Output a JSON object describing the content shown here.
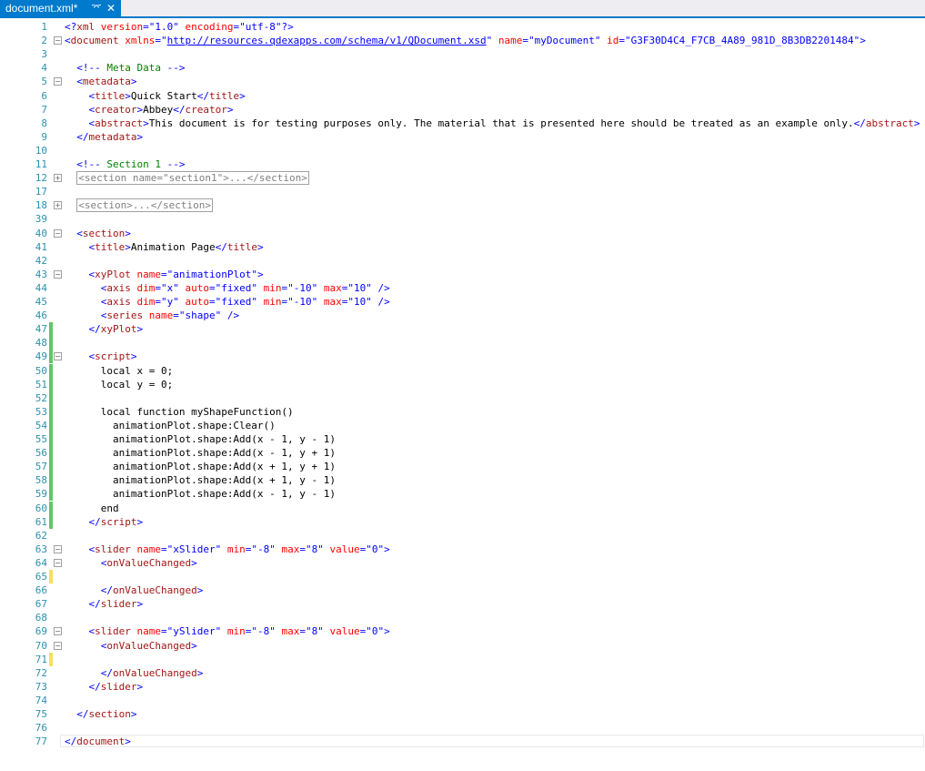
{
  "tab": {
    "title": "document.xml*",
    "pin_icon": "pin-icon",
    "close_icon": "close-icon"
  },
  "colors": {
    "tag": "#a31515",
    "attr_name": "#ff0000",
    "attr_value": "#0000ff",
    "bracket": "#0000ff",
    "comment": "#008000",
    "link": "#0000ff",
    "line_number": "#2b91af",
    "accent": "#007acc",
    "saved_change": "#5fc85f",
    "unsaved_change": "#f5e15a"
  },
  "lines": [
    {
      "n": "1",
      "fold": "",
      "change": "",
      "segs": [
        [
          "b",
          "<?"
        ],
        [
          "t",
          "xml"
        ],
        [
          "t",
          " "
        ],
        [
          "a",
          "version"
        ],
        [
          "b",
          "="
        ],
        [
          "v",
          "\"1.0\""
        ],
        [
          "t",
          " "
        ],
        [
          "a",
          "encoding"
        ],
        [
          "b",
          "="
        ],
        [
          "v",
          "\"utf-8\""
        ],
        [
          "b",
          "?>"
        ]
      ]
    },
    {
      "n": "2",
      "fold": "minus",
      "change": "",
      "segs": [
        [
          "b",
          "<"
        ],
        [
          "t",
          "document"
        ],
        [
          "t",
          " "
        ],
        [
          "a",
          "xmlns"
        ],
        [
          "b",
          "="
        ],
        [
          "b",
          "\""
        ],
        [
          "l",
          "http://resources.qdexapps.com/schema/v1/QDocument.xsd"
        ],
        [
          "b",
          "\""
        ],
        [
          "t",
          " "
        ],
        [
          "a",
          "name"
        ],
        [
          "b",
          "="
        ],
        [
          "v",
          "\"myDocument\""
        ],
        [
          "t",
          " "
        ],
        [
          "a",
          "id"
        ],
        [
          "b",
          "="
        ],
        [
          "v",
          "\"G3F30D4C4_F7CB_4A89_981D_8B3DB2201484\""
        ],
        [
          "b",
          ">"
        ]
      ]
    },
    {
      "n": "3",
      "fold": "",
      "change": "",
      "segs": []
    },
    {
      "n": "4",
      "fold": "",
      "change": "",
      "segs": [
        [
          "p",
          "  "
        ],
        [
          "b",
          "<!--"
        ],
        [
          "c",
          " Meta Data "
        ],
        [
          "b",
          "-->"
        ]
      ]
    },
    {
      "n": "5",
      "fold": "minus",
      "change": "",
      "segs": [
        [
          "p",
          "  "
        ],
        [
          "b",
          "<"
        ],
        [
          "t",
          "metadata"
        ],
        [
          "b",
          ">"
        ]
      ]
    },
    {
      "n": "6",
      "fold": "",
      "change": "",
      "segs": [
        [
          "p",
          "    "
        ],
        [
          "b",
          "<"
        ],
        [
          "t",
          "title"
        ],
        [
          "b",
          ">"
        ],
        [
          "x",
          "Quick Start"
        ],
        [
          "b",
          "</"
        ],
        [
          "t",
          "title"
        ],
        [
          "b",
          ">"
        ]
      ]
    },
    {
      "n": "7",
      "fold": "",
      "change": "",
      "segs": [
        [
          "p",
          "    "
        ],
        [
          "b",
          "<"
        ],
        [
          "t",
          "creator"
        ],
        [
          "b",
          ">"
        ],
        [
          "x",
          "Abbey"
        ],
        [
          "b",
          "</"
        ],
        [
          "t",
          "creator"
        ],
        [
          "b",
          ">"
        ]
      ]
    },
    {
      "n": "8",
      "fold": "",
      "change": "",
      "segs": [
        [
          "p",
          "    "
        ],
        [
          "b",
          "<"
        ],
        [
          "t",
          "abstract"
        ],
        [
          "b",
          ">"
        ],
        [
          "x",
          "This document is for testing purposes only. The material that is presented here should be treated as an example only."
        ],
        [
          "b",
          "</"
        ],
        [
          "t",
          "abstract"
        ],
        [
          "b",
          ">"
        ]
      ]
    },
    {
      "n": "9",
      "fold": "",
      "change": "",
      "segs": [
        [
          "p",
          "  "
        ],
        [
          "b",
          "</"
        ],
        [
          "t",
          "metadata"
        ],
        [
          "b",
          ">"
        ]
      ]
    },
    {
      "n": "10",
      "fold": "",
      "change": "",
      "segs": []
    },
    {
      "n": "11",
      "fold": "",
      "change": "",
      "segs": [
        [
          "p",
          "  "
        ],
        [
          "b",
          "<!--"
        ],
        [
          "c",
          " Section 1 "
        ],
        [
          "b",
          "-->"
        ]
      ]
    },
    {
      "n": "12",
      "fold": "plus",
      "change": "",
      "segs": [
        [
          "p",
          "  "
        ],
        [
          "k",
          "<section name=\"section1\">...</section>"
        ]
      ]
    },
    {
      "n": "17",
      "fold": "",
      "change": "",
      "segs": []
    },
    {
      "n": "18",
      "fold": "plus",
      "change": "",
      "segs": [
        [
          "p",
          "  "
        ],
        [
          "k",
          "<section>...</section>"
        ]
      ]
    },
    {
      "n": "39",
      "fold": "",
      "change": "",
      "segs": []
    },
    {
      "n": "40",
      "fold": "minus",
      "change": "",
      "segs": [
        [
          "p",
          "  "
        ],
        [
          "b",
          "<"
        ],
        [
          "t",
          "section"
        ],
        [
          "b",
          ">"
        ]
      ]
    },
    {
      "n": "41",
      "fold": "",
      "change": "",
      "segs": [
        [
          "p",
          "    "
        ],
        [
          "b",
          "<"
        ],
        [
          "t",
          "title"
        ],
        [
          "b",
          ">"
        ],
        [
          "x",
          "Animation Page"
        ],
        [
          "b",
          "</"
        ],
        [
          "t",
          "title"
        ],
        [
          "b",
          ">"
        ]
      ]
    },
    {
      "n": "42",
      "fold": "",
      "change": "",
      "segs": []
    },
    {
      "n": "43",
      "fold": "minus",
      "change": "",
      "segs": [
        [
          "p",
          "    "
        ],
        [
          "b",
          "<"
        ],
        [
          "t",
          "xyPlot"
        ],
        [
          "t",
          " "
        ],
        [
          "a",
          "name"
        ],
        [
          "b",
          "="
        ],
        [
          "v",
          "\"animationPlot\""
        ],
        [
          "b",
          ">"
        ]
      ]
    },
    {
      "n": "44",
      "fold": "",
      "change": "",
      "segs": [
        [
          "p",
          "      "
        ],
        [
          "b",
          "<"
        ],
        [
          "t",
          "axis"
        ],
        [
          "t",
          " "
        ],
        [
          "a",
          "dim"
        ],
        [
          "b",
          "="
        ],
        [
          "v",
          "\"x\""
        ],
        [
          "t",
          " "
        ],
        [
          "a",
          "auto"
        ],
        [
          "b",
          "="
        ],
        [
          "v",
          "\"fixed\""
        ],
        [
          "t",
          " "
        ],
        [
          "a",
          "min"
        ],
        [
          "b",
          "="
        ],
        [
          "v",
          "\"-10\""
        ],
        [
          "t",
          " "
        ],
        [
          "a",
          "max"
        ],
        [
          "b",
          "="
        ],
        [
          "v",
          "\"10\""
        ],
        [
          "t",
          " "
        ],
        [
          "b",
          "/>"
        ]
      ]
    },
    {
      "n": "45",
      "fold": "",
      "change": "",
      "segs": [
        [
          "p",
          "      "
        ],
        [
          "b",
          "<"
        ],
        [
          "t",
          "axis"
        ],
        [
          "t",
          " "
        ],
        [
          "a",
          "dim"
        ],
        [
          "b",
          "="
        ],
        [
          "v",
          "\"y\""
        ],
        [
          "t",
          " "
        ],
        [
          "a",
          "auto"
        ],
        [
          "b",
          "="
        ],
        [
          "v",
          "\"fixed\""
        ],
        [
          "t",
          " "
        ],
        [
          "a",
          "min"
        ],
        [
          "b",
          "="
        ],
        [
          "v",
          "\"-10\""
        ],
        [
          "t",
          " "
        ],
        [
          "a",
          "max"
        ],
        [
          "b",
          "="
        ],
        [
          "v",
          "\"10\""
        ],
        [
          "t",
          " "
        ],
        [
          "b",
          "/>"
        ]
      ]
    },
    {
      "n": "46",
      "fold": "",
      "change": "",
      "segs": [
        [
          "p",
          "      "
        ],
        [
          "b",
          "<"
        ],
        [
          "t",
          "series"
        ],
        [
          "t",
          " "
        ],
        [
          "a",
          "name"
        ],
        [
          "b",
          "="
        ],
        [
          "v",
          "\"shape\""
        ],
        [
          "t",
          " "
        ],
        [
          "b",
          "/>"
        ]
      ]
    },
    {
      "n": "47",
      "fold": "",
      "change": "saved",
      "segs": [
        [
          "p",
          "    "
        ],
        [
          "b",
          "</"
        ],
        [
          "t",
          "xyPlot"
        ],
        [
          "b",
          ">"
        ]
      ]
    },
    {
      "n": "48",
      "fold": "",
      "change": "saved",
      "segs": []
    },
    {
      "n": "49",
      "fold": "minus",
      "change": "saved",
      "segs": [
        [
          "p",
          "    "
        ],
        [
          "b",
          "<"
        ],
        [
          "t",
          "script"
        ],
        [
          "b",
          ">"
        ]
      ]
    },
    {
      "n": "50",
      "fold": "",
      "change": "saved",
      "segs": [
        [
          "p",
          "      "
        ],
        [
          "x",
          "local x = 0;"
        ]
      ]
    },
    {
      "n": "51",
      "fold": "",
      "change": "saved",
      "segs": [
        [
          "p",
          "      "
        ],
        [
          "x",
          "local y = 0;"
        ]
      ]
    },
    {
      "n": "52",
      "fold": "",
      "change": "saved",
      "segs": []
    },
    {
      "n": "53",
      "fold": "",
      "change": "saved",
      "segs": [
        [
          "p",
          "      "
        ],
        [
          "x",
          "local function myShapeFunction()"
        ]
      ]
    },
    {
      "n": "54",
      "fold": "",
      "change": "saved",
      "segs": [
        [
          "p",
          "        "
        ],
        [
          "x",
          "animationPlot.shape:Clear()"
        ]
      ]
    },
    {
      "n": "55",
      "fold": "",
      "change": "saved",
      "segs": [
        [
          "p",
          "        "
        ],
        [
          "x",
          "animationPlot.shape:Add(x - 1, y - 1)"
        ]
      ]
    },
    {
      "n": "56",
      "fold": "",
      "change": "saved",
      "segs": [
        [
          "p",
          "        "
        ],
        [
          "x",
          "animationPlot.shape:Add(x - 1, y + 1)"
        ]
      ]
    },
    {
      "n": "57",
      "fold": "",
      "change": "saved",
      "segs": [
        [
          "p",
          "        "
        ],
        [
          "x",
          "animationPlot.shape:Add(x + 1, y + 1)"
        ]
      ]
    },
    {
      "n": "58",
      "fold": "",
      "change": "saved",
      "segs": [
        [
          "p",
          "        "
        ],
        [
          "x",
          "animationPlot.shape:Add(x + 1, y - 1)"
        ]
      ]
    },
    {
      "n": "59",
      "fold": "",
      "change": "saved",
      "segs": [
        [
          "p",
          "        "
        ],
        [
          "x",
          "animationPlot.shape:Add(x - 1, y - 1)"
        ]
      ]
    },
    {
      "n": "60",
      "fold": "",
      "change": "saved",
      "segs": [
        [
          "p",
          "      "
        ],
        [
          "x",
          "end"
        ]
      ]
    },
    {
      "n": "61",
      "fold": "",
      "change": "saved",
      "segs": [
        [
          "p",
          "    "
        ],
        [
          "b",
          "</"
        ],
        [
          "t",
          "script"
        ],
        [
          "b",
          ">"
        ]
      ]
    },
    {
      "n": "62",
      "fold": "",
      "change": "",
      "segs": []
    },
    {
      "n": "63",
      "fold": "minus",
      "change": "",
      "segs": [
        [
          "p",
          "    "
        ],
        [
          "b",
          "<"
        ],
        [
          "t",
          "slider"
        ],
        [
          "t",
          " "
        ],
        [
          "a",
          "name"
        ],
        [
          "b",
          "="
        ],
        [
          "v",
          "\"xSlider\""
        ],
        [
          "t",
          " "
        ],
        [
          "a",
          "min"
        ],
        [
          "b",
          "="
        ],
        [
          "v",
          "\"-8\""
        ],
        [
          "t",
          " "
        ],
        [
          "a",
          "max"
        ],
        [
          "b",
          "="
        ],
        [
          "v",
          "\"8\""
        ],
        [
          "t",
          " "
        ],
        [
          "a",
          "value"
        ],
        [
          "b",
          "="
        ],
        [
          "v",
          "\"0\""
        ],
        [
          "b",
          ">"
        ]
      ]
    },
    {
      "n": "64",
      "fold": "minus",
      "change": "",
      "segs": [
        [
          "p",
          "      "
        ],
        [
          "b",
          "<"
        ],
        [
          "t",
          "onValueChanged"
        ],
        [
          "b",
          ">"
        ]
      ]
    },
    {
      "n": "65",
      "fold": "",
      "change": "unsaved",
      "segs": []
    },
    {
      "n": "66",
      "fold": "",
      "change": "",
      "segs": [
        [
          "p",
          "      "
        ],
        [
          "b",
          "</"
        ],
        [
          "t",
          "onValueChanged"
        ],
        [
          "b",
          ">"
        ]
      ]
    },
    {
      "n": "67",
      "fold": "",
      "change": "",
      "segs": [
        [
          "p",
          "    "
        ],
        [
          "b",
          "</"
        ],
        [
          "t",
          "slider"
        ],
        [
          "b",
          ">"
        ]
      ]
    },
    {
      "n": "68",
      "fold": "",
      "change": "",
      "segs": []
    },
    {
      "n": "69",
      "fold": "minus",
      "change": "",
      "segs": [
        [
          "p",
          "    "
        ],
        [
          "b",
          "<"
        ],
        [
          "t",
          "slider"
        ],
        [
          "t",
          " "
        ],
        [
          "a",
          "name"
        ],
        [
          "b",
          "="
        ],
        [
          "v",
          "\"ySlider\""
        ],
        [
          "t",
          " "
        ],
        [
          "a",
          "min"
        ],
        [
          "b",
          "="
        ],
        [
          "v",
          "\"-8\""
        ],
        [
          "t",
          " "
        ],
        [
          "a",
          "max"
        ],
        [
          "b",
          "="
        ],
        [
          "v",
          "\"8\""
        ],
        [
          "t",
          " "
        ],
        [
          "a",
          "value"
        ],
        [
          "b",
          "="
        ],
        [
          "v",
          "\"0\""
        ],
        [
          "b",
          ">"
        ]
      ]
    },
    {
      "n": "70",
      "fold": "minus",
      "change": "",
      "segs": [
        [
          "p",
          "      "
        ],
        [
          "b",
          "<"
        ],
        [
          "t",
          "onValueChanged"
        ],
        [
          "b",
          ">"
        ]
      ]
    },
    {
      "n": "71",
      "fold": "",
      "change": "unsaved",
      "segs": []
    },
    {
      "n": "72",
      "fold": "",
      "change": "",
      "segs": [
        [
          "p",
          "      "
        ],
        [
          "b",
          "</"
        ],
        [
          "t",
          "onValueChanged"
        ],
        [
          "b",
          ">"
        ]
      ]
    },
    {
      "n": "73",
      "fold": "",
      "change": "",
      "segs": [
        [
          "p",
          "    "
        ],
        [
          "b",
          "</"
        ],
        [
          "t",
          "slider"
        ],
        [
          "b",
          ">"
        ]
      ]
    },
    {
      "n": "74",
      "fold": "",
      "change": "",
      "segs": []
    },
    {
      "n": "75",
      "fold": "",
      "change": "",
      "segs": [
        [
          "p",
          "  "
        ],
        [
          "b",
          "</"
        ],
        [
          "t",
          "section"
        ],
        [
          "b",
          ">"
        ]
      ]
    },
    {
      "n": "76",
      "fold": "",
      "change": "",
      "segs": []
    },
    {
      "n": "77",
      "fold": "",
      "change": "",
      "segs": [
        [
          "b",
          "</"
        ],
        [
          "t",
          "document"
        ],
        [
          "b",
          ">"
        ]
      ]
    }
  ]
}
